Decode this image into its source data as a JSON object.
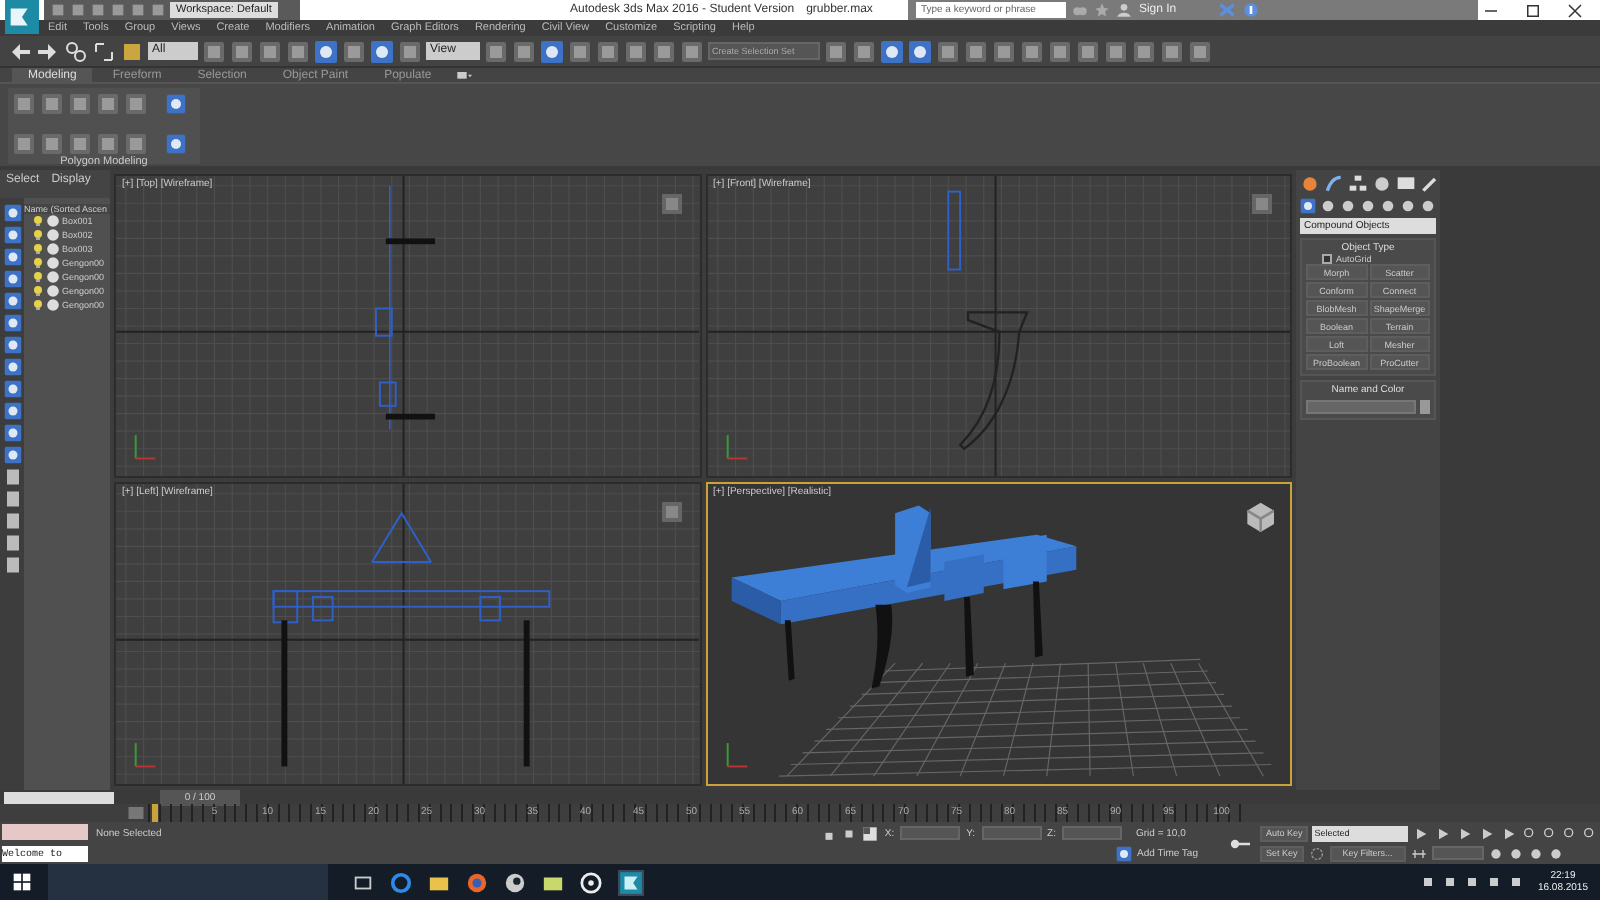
{
  "title_bar": {
    "workspace": "Workspace: Default",
    "title": "Autodesk 3ds Max 2016 - Student Version",
    "file": "grubber.max",
    "search": {
      "placeholder": "Type a keyword or phrase"
    },
    "sign_in": "Sign In"
  },
  "menu": [
    "Edit",
    "Tools",
    "Group",
    "Views",
    "Create",
    "Modifiers",
    "Animation",
    "Graph Editors",
    "Rendering",
    "Civil View",
    "Customize",
    "Scripting",
    "Help"
  ],
  "toolbar": {
    "selection_filter": "All",
    "reference_coord": "View",
    "selection_set": {
      "placeholder": "Create Selection Set"
    }
  },
  "ribbon": {
    "tabs": [
      {
        "label": "Modeling",
        "selected": true
      },
      {
        "label": "Freeform",
        "selected": false
      },
      {
        "label": "Selection",
        "selected": false
      },
      {
        "label": "Object Paint",
        "selected": false
      },
      {
        "label": "Populate",
        "selected": false
      }
    ],
    "panel_title": "Polygon Modeling"
  },
  "scene_explorer": {
    "tabs": [
      "Select",
      "Display"
    ],
    "column": "Name (Sorted Ascen",
    "items": [
      "Box001",
      "Box002",
      "Box003",
      "Gengon00",
      "Gengon00",
      "Gengon00",
      "Gengon00"
    ]
  },
  "viewports": [
    {
      "kind": "top",
      "label": "[+] [Top] [Wireframe]",
      "active": false
    },
    {
      "kind": "front",
      "label": "[+] [Front] [Wireframe]",
      "active": false
    },
    {
      "kind": "left",
      "label": "[+] [Left] [Wireframe]",
      "active": false
    },
    {
      "kind": "perspective",
      "label": "[+] [Perspective] [Realistic]",
      "active": true
    }
  ],
  "command_panel": {
    "dropdown": "Compound Objects",
    "object_type": {
      "title": "Object Type",
      "autogrid": {
        "label": "AutoGrid",
        "checked": false
      },
      "buttons": [
        "Morph",
        "Scatter",
        "Conform",
        "Connect",
        "BlobMesh",
        "ShapeMerge",
        "Boolean",
        "Terrain",
        "Loft",
        "Mesher",
        "ProBoolean",
        "ProCutter"
      ]
    },
    "name_and_color": {
      "title": "Name and Color"
    }
  },
  "timeline": {
    "slider": "0 / 100",
    "ruler": [
      "5",
      "10",
      "15",
      "20",
      "25",
      "30",
      "35",
      "40",
      "45",
      "50",
      "55",
      "60",
      "65",
      "70",
      "75",
      "80",
      "85",
      "90",
      "95",
      "100"
    ]
  },
  "status": {
    "script": "Welcome to",
    "selection": "None Selected",
    "x_label": "X:",
    "y_label": "Y:",
    "z_label": "Z:",
    "grid": "Grid = 10,0",
    "add_time_tag": "Add Time Tag",
    "auto_key": "Auto Key",
    "key_mode": "Selected",
    "set_key": "Set Key",
    "key_filters": "Key Filters..."
  },
  "taskbar": {
    "time": "22:19",
    "date": "16.08.2015"
  }
}
